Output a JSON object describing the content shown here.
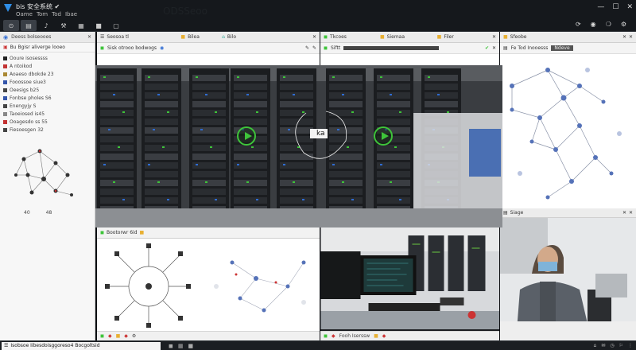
{
  "app": {
    "title": "bis 安全系统 ✔",
    "menu": [
      "Oame",
      "Tom",
      "Tod",
      "Ibae"
    ],
    "watermark": "ODSSeoo"
  },
  "toolbar": {
    "buttons": [
      {
        "icon": "pin-icon",
        "glyph": "⊙",
        "active": true
      },
      {
        "icon": "document-icon",
        "glyph": "▤",
        "active": true
      },
      {
        "icon": "mic-icon",
        "glyph": "♪",
        "active": false
      },
      {
        "icon": "tools-icon",
        "glyph": "⚒",
        "active": false
      },
      {
        "icon": "grid-icon",
        "glyph": "▦",
        "active": false
      },
      {
        "icon": "folder-icon",
        "glyph": "■",
        "active": false
      },
      {
        "icon": "window-icon",
        "glyph": "▢",
        "active": false
      }
    ],
    "right_icons": [
      "⟳",
      "◉",
      "❍",
      "⚙"
    ]
  },
  "left_panel": {
    "header": "Deess bolseooes",
    "search": "Bu Bgisr aliverge looeo",
    "items": [
      {
        "label": "Ooure isosessss",
        "color": "#222222"
      },
      {
        "label": "A ntoikod",
        "color": "#c33333"
      },
      {
        "label": "Aoaeso dbokde 23",
        "color": "#aa8833"
      },
      {
        "label": "Fooossoe siue3",
        "color": "#3355aa"
      },
      {
        "label": "Oeesigs b25",
        "color": "#444444"
      },
      {
        "label": "Fonbse pholes S6",
        "color": "#3355aa"
      },
      {
        "label": "Enengyjy S",
        "color": "#444444"
      },
      {
        "label": "Taoeiosed is45",
        "color": "#888888"
      },
      {
        "label": "Ooagesdo ss 55",
        "color": "#c33333"
      },
      {
        "label": "Fiesoesgen 32",
        "color": "#444444"
      }
    ],
    "footer": [
      "40",
      "48"
    ]
  },
  "panels": {
    "p1": {
      "title": "Seosoa tl",
      "sub": "Sisk otrooo bodwogs"
    },
    "p1b": {
      "title": "Bilea"
    },
    "p1c": {
      "title": "Bilo"
    },
    "p2": {
      "title": "Tkcoes",
      "sub": "Siftt"
    },
    "p2b": {
      "title": "Siemaa"
    },
    "p2c": {
      "title": "Filer"
    },
    "p3": {
      "title": "Sfeobe",
      "sub": "Fe Tod Inooesss"
    },
    "p3b": {
      "title": "Ndeve"
    },
    "p4": {
      "title": "Bootorwr 6id"
    },
    "p5": {
      "title": "Fooh Iserssw"
    },
    "p6": {
      "title": "Siage"
    }
  },
  "overlay": {
    "center_label": "ka"
  },
  "statusbar": {
    "search": "Isobsoe Iibesdoisggoreso4 Bocgoltsid",
    "right": [
      "⌂",
      "✉",
      "◷",
      "⚐",
      "⋮"
    ]
  },
  "colors": {
    "accent_green": "#3ec43a",
    "accent_blue": "#2f6cd3"
  }
}
